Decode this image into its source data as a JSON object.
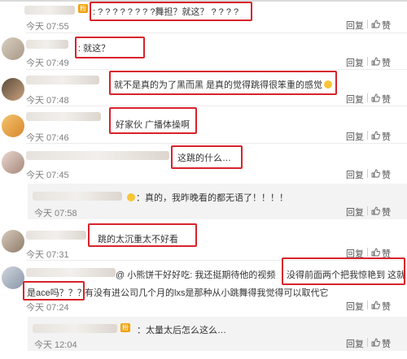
{
  "actions": {
    "reply": "回复",
    "like": "赞"
  },
  "comments": [
    {
      "text": ": ? ? ? ? ? ? ? ?舞担？就这？ ? ? ? ?",
      "time": "今天 07:55"
    },
    {
      "text": ": 就这？",
      "time": "今天 07:49"
    },
    {
      "text": "就不是真的为了黑而黑 是真的觉得跳得很笨重的感觉",
      "time": "今天 07:48"
    },
    {
      "text": "好家伙 广播体操啊",
      "time": "今天 07:46"
    },
    {
      "text": "这跳的什么…",
      "time": "今天 07:45"
    },
    {
      "text": "：真的，我昨晚看的都无语了！！！！",
      "time": "今天 07:58"
    },
    {
      "text": "跳的太沉重太不好看",
      "time": "今天 07:31"
    },
    {
      "text_a": "@ 小熊饼干好好吃: 我还挺期待他的视频",
      "text_b": "没得前面两个把我惊艳到 这就",
      "text_c": "是ace吗？？？",
      "text_d": " 有没有进公司几个月的lxs是那种从小跳舞得我觉得可以取代它",
      "time": "今天 07:24"
    },
    {
      "text": "：太量太后怎么这么…",
      "time": "今天 12:04"
    }
  ],
  "badge": "粉",
  "colors": {
    "highlight": "#d8232a",
    "meta": "#808080"
  }
}
